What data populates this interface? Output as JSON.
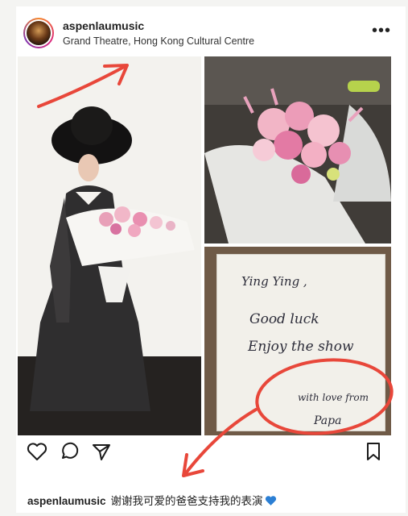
{
  "post": {
    "username": "aspenlaumusic",
    "location": "Grand Theatre, Hong Kong Cultural Centre",
    "more_label": "•••",
    "caption_username": "aspenlaumusic",
    "caption_text": "谢谢我可爱的爸爸支持我的表演"
  },
  "card": {
    "line1": "Ying Ying ,",
    "line2": "Good luck",
    "line3": "Enjoy  the  show",
    "line4": "with  love  from",
    "line5": "Papa"
  },
  "colors": {
    "annotation": "#e8473a",
    "heart": "#2b7fd4"
  },
  "icons": [
    "like-heart-icon",
    "comment-icon",
    "share-icon",
    "save-bookmark-icon",
    "more-options-icon"
  ]
}
